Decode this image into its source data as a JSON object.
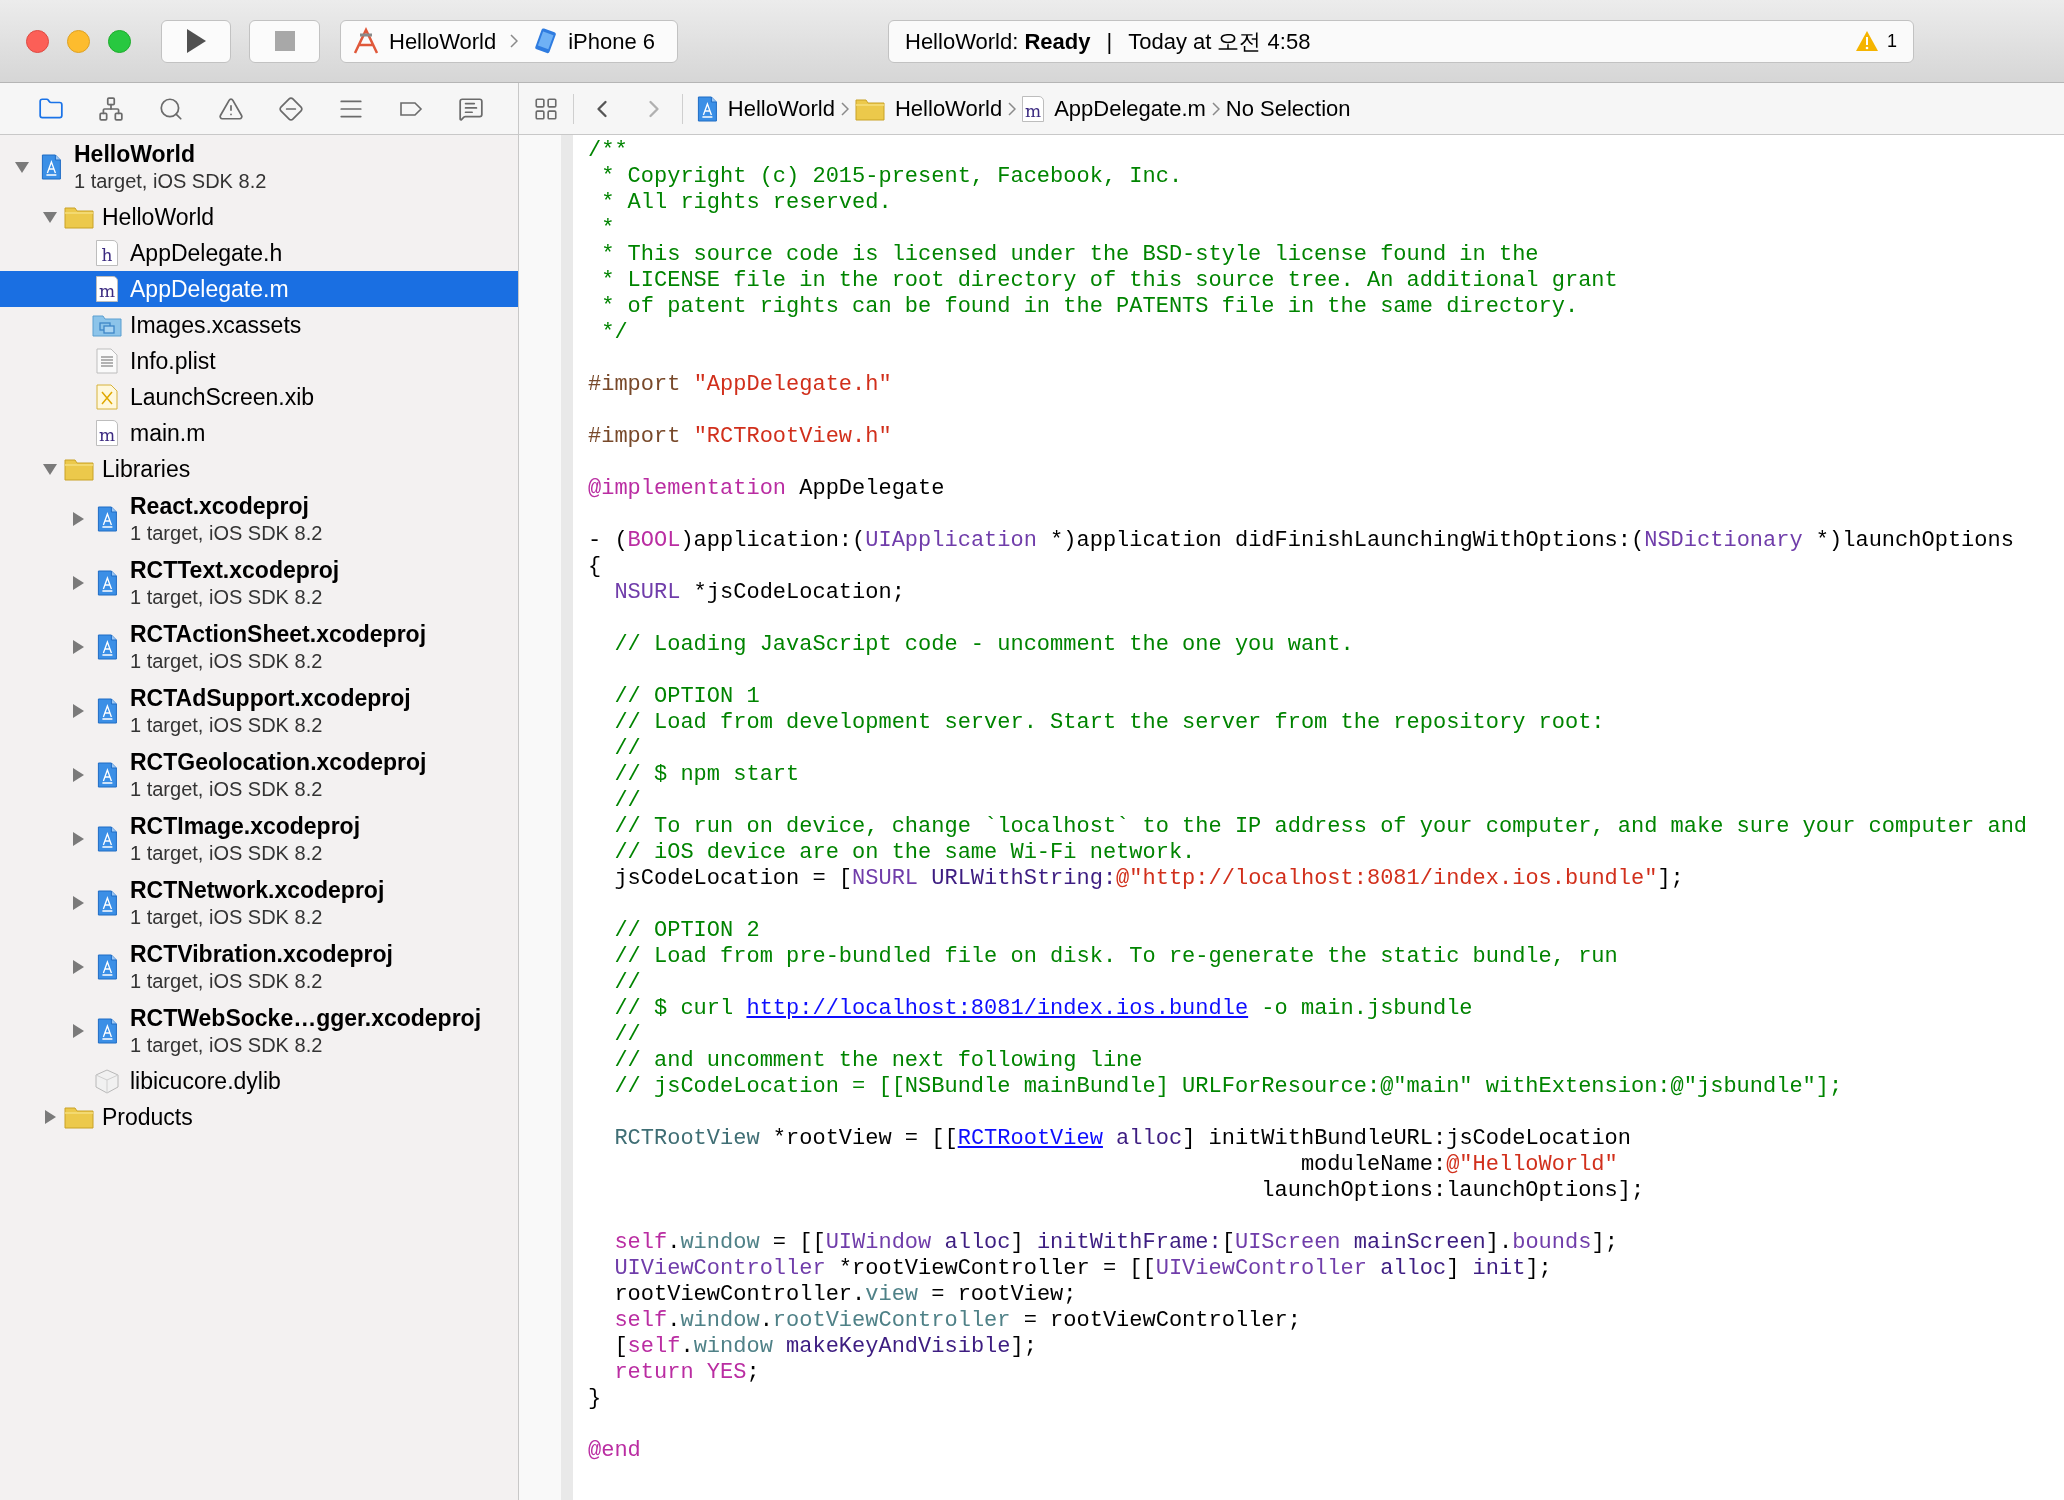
{
  "toolbar": {
    "scheme": {
      "project": "HelloWorld",
      "device": "iPhone 6"
    },
    "status": {
      "message": "HelloWorld: **Ready**",
      "separator": "|",
      "time": "Today at 오전 4:58"
    },
    "warnings": "1"
  },
  "navigator_tabs": [
    {
      "kind": "files",
      "selected": true
    },
    {
      "kind": "symbols",
      "selected": false
    },
    {
      "kind": "find",
      "selected": false
    },
    {
      "kind": "issues",
      "selected": false
    },
    {
      "kind": "tests",
      "selected": false
    },
    {
      "kind": "debug",
      "selected": false
    },
    {
      "kind": "breakpoints",
      "selected": false
    },
    {
      "kind": "reports",
      "selected": false
    }
  ],
  "jump_bar": [
    {
      "kind": "project",
      "label": "HelloWorld"
    },
    {
      "kind": "folder",
      "label": "HelloWorld"
    },
    {
      "kind": "source",
      "letter": "m",
      "label": "AppDelegate.m"
    },
    {
      "kind": "text",
      "label": "No Selection"
    }
  ],
  "project_navigator": {
    "items": [
      {
        "kind": "project",
        "name": "HelloWorld",
        "subtitle": "1 target, iOS SDK 8.2",
        "expanded": true,
        "selected": false,
        "children": [
          {
            "kind": "folder",
            "name": "HelloWorld",
            "expanded": true,
            "selected": false,
            "children": [
              {
                "kind": "source",
                "letter": "h",
                "name": "AppDelegate.h",
                "selected": false
              },
              {
                "kind": "source",
                "letter": "m",
                "name": "AppDelegate.m",
                "selected": true
              },
              {
                "kind": "assets",
                "name": "Images.xcassets",
                "selected": false
              },
              {
                "kind": "plist",
                "name": "Info.plist",
                "selected": false
              },
              {
                "kind": "xib",
                "name": "LaunchScreen.xib",
                "selected": false
              },
              {
                "kind": "source",
                "letter": "m",
                "name": "main.m",
                "selected": false
              }
            ]
          },
          {
            "kind": "folder",
            "name": "Libraries",
            "expanded": true,
            "selected": false,
            "children": [
              {
                "kind": "project",
                "name": "React.xcodeproj",
                "subtitle": "1 target, iOS SDK 8.2",
                "expanded": false,
                "selected": false
              },
              {
                "kind": "project",
                "name": "RCTText.xcodeproj",
                "subtitle": "1 target, iOS SDK 8.2",
                "expanded": false,
                "selected": false
              },
              {
                "kind": "project",
                "name": "RCTActionSheet.xcodeproj",
                "subtitle": "1 target, iOS SDK 8.2",
                "expanded": false,
                "selected": false
              },
              {
                "kind": "project",
                "name": "RCTAdSupport.xcodeproj",
                "subtitle": "1 target, iOS SDK 8.2",
                "expanded": false,
                "selected": false
              },
              {
                "kind": "project",
                "name": "RCTGeolocation.xcodeproj",
                "subtitle": "1 target, iOS SDK 8.2",
                "expanded": false,
                "selected": false
              },
              {
                "kind": "project",
                "name": "RCTImage.xcodeproj",
                "subtitle": "1 target, iOS SDK 8.2",
                "expanded": false,
                "selected": false
              },
              {
                "kind": "project",
                "name": "RCTNetwork.xcodeproj",
                "subtitle": "1 target, iOS SDK 8.2",
                "expanded": false,
                "selected": false
              },
              {
                "kind": "project",
                "name": "RCTVibration.xcodeproj",
                "subtitle": "1 target, iOS SDK 8.2",
                "expanded": false,
                "selected": false
              },
              {
                "kind": "project",
                "name": "RCTWebSocke…gger.xcodeproj",
                "subtitle": "1 target, iOS SDK 8.2",
                "expanded": false,
                "selected": false
              },
              {
                "kind": "dylib",
                "name": "libicucore.dylib",
                "selected": false
              }
            ]
          },
          {
            "kind": "folder",
            "name": "Products",
            "expanded": false,
            "selected": false
          }
        ]
      }
    ]
  },
  "editor": {
    "lines": [
      {
        "kind": "code",
        "tokens": [
          {
            "kind": "comment",
            "text": "/**"
          }
        ]
      },
      {
        "kind": "code",
        "tokens": [
          {
            "kind": "comment",
            "text": " * Copyright (c) 2015-present, Facebook, Inc."
          }
        ]
      },
      {
        "kind": "code",
        "tokens": [
          {
            "kind": "comment",
            "text": " * All rights reserved."
          }
        ]
      },
      {
        "kind": "code",
        "tokens": [
          {
            "kind": "comment",
            "text": " *"
          }
        ]
      },
      {
        "kind": "code",
        "tokens": [
          {
            "kind": "comment",
            "text": " * This source code is licensed under the BSD-style license found in the"
          }
        ]
      },
      {
        "kind": "code",
        "tokens": [
          {
            "kind": "comment",
            "text": " * LICENSE file in the root directory of this source tree. An additional grant"
          }
        ]
      },
      {
        "kind": "code",
        "tokens": [
          {
            "kind": "comment",
            "text": " * of patent rights can be found in the PATENTS file in the same directory."
          }
        ]
      },
      {
        "kind": "code",
        "tokens": [
          {
            "kind": "comment",
            "text": " */"
          }
        ]
      },
      {
        "kind": "blank"
      },
      {
        "kind": "code",
        "tokens": [
          {
            "kind": "directive",
            "text": "#import "
          },
          {
            "kind": "string",
            "text": "\"AppDelegate.h\""
          }
        ]
      },
      {
        "kind": "blank"
      },
      {
        "kind": "code",
        "tokens": [
          {
            "kind": "directive",
            "text": "#import "
          },
          {
            "kind": "string",
            "text": "\"RCTRootView.h\""
          }
        ]
      },
      {
        "kind": "blank"
      },
      {
        "kind": "code",
        "tokens": [
          {
            "kind": "keyword",
            "text": "@implementation"
          },
          {
            "kind": "plain",
            "text": " AppDelegate"
          }
        ]
      },
      {
        "kind": "blank"
      },
      {
        "kind": "code",
        "tokens": [
          {
            "kind": "plain",
            "text": "- ("
          },
          {
            "kind": "keyword",
            "text": "BOOL"
          },
          {
            "kind": "plain",
            "text": ")application:("
          },
          {
            "kind": "type",
            "text": "UIApplication"
          },
          {
            "kind": "plain",
            "text": " *)application didFinishLaunchingWithOptions:("
          },
          {
            "kind": "type",
            "text": "NSDictionary"
          },
          {
            "kind": "plain",
            "text": " *)launchOptions"
          }
        ]
      },
      {
        "kind": "code",
        "tokens": [
          {
            "kind": "plain",
            "text": "{"
          }
        ]
      },
      {
        "kind": "code",
        "tokens": [
          {
            "kind": "type",
            "text": "  NSURL"
          },
          {
            "kind": "plain",
            "text": " *jsCodeLocation;"
          }
        ]
      },
      {
        "kind": "blank"
      },
      {
        "kind": "code",
        "tokens": [
          {
            "kind": "comment",
            "text": "  // Loading JavaScript code - uncomment the one you want."
          }
        ]
      },
      {
        "kind": "blank"
      },
      {
        "kind": "code",
        "tokens": [
          {
            "kind": "comment",
            "text": "  // OPTION 1"
          }
        ]
      },
      {
        "kind": "code",
        "tokens": [
          {
            "kind": "comment",
            "text": "  // Load from development server. Start the server from the repository root:"
          }
        ]
      },
      {
        "kind": "code",
        "tokens": [
          {
            "kind": "comment",
            "text": "  //"
          }
        ]
      },
      {
        "kind": "code",
        "tokens": [
          {
            "kind": "comment",
            "text": "  // $ npm start"
          }
        ]
      },
      {
        "kind": "code",
        "tokens": [
          {
            "kind": "comment",
            "text": "  //"
          }
        ]
      },
      {
        "kind": "code",
        "tokens": [
          {
            "kind": "comment",
            "text": "  // To run on device, change `localhost` to the IP address of your computer, and make sure your computer and"
          }
        ]
      },
      {
        "kind": "code",
        "tokens": [
          {
            "kind": "comment",
            "text": "  // iOS device are on the same Wi-Fi network."
          }
        ]
      },
      {
        "kind": "code",
        "tokens": [
          {
            "kind": "plain",
            "text": "  jsCodeLocation = ["
          },
          {
            "kind": "type",
            "text": "NSURL"
          },
          {
            "kind": "method",
            "text": " URLWithString:"
          },
          {
            "kind": "string",
            "text": "@\"http://localhost:8081/index.ios.bundle\""
          },
          {
            "kind": "plain",
            "text": "];"
          }
        ]
      },
      {
        "kind": "blank"
      },
      {
        "kind": "code",
        "tokens": [
          {
            "kind": "comment",
            "text": "  // OPTION 2"
          }
        ]
      },
      {
        "kind": "code",
        "tokens": [
          {
            "kind": "comment",
            "text": "  // Load from pre-bundled file on disk. To re-generate the static bundle, run"
          }
        ]
      },
      {
        "kind": "code",
        "tokens": [
          {
            "kind": "comment",
            "text": "  //"
          }
        ]
      },
      {
        "kind": "code",
        "tokens": [
          {
            "kind": "comment",
            "text": "  // $ curl "
          },
          {
            "kind": "link",
            "text": "http://localhost:8081/index.ios.bundle"
          },
          {
            "kind": "comment",
            "text": " -o main.jsbundle"
          }
        ]
      },
      {
        "kind": "code",
        "tokens": [
          {
            "kind": "comment",
            "text": "  //"
          }
        ]
      },
      {
        "kind": "code",
        "tokens": [
          {
            "kind": "comment",
            "text": "  // and uncomment the next following line"
          }
        ]
      },
      {
        "kind": "code",
        "tokens": [
          {
            "kind": "comment",
            "text": "  // jsCodeLocation = [[NSBundle mainBundle] URLForResource:@\"main\" withExtension:@\"jsbundle\"];"
          }
        ]
      },
      {
        "kind": "blank"
      },
      {
        "kind": "code",
        "tokens": [
          {
            "kind": "class",
            "text": "  RCTRootView"
          },
          {
            "kind": "plain",
            "text": " *rootView = [["
          },
          {
            "kind": "link",
            "text": "RCTRootView"
          },
          {
            "kind": "method",
            "text": " alloc"
          },
          {
            "kind": "plain",
            "text": "] initWithBundleURL:jsCodeLocation"
          }
        ]
      },
      {
        "kind": "code",
        "tokens": [
          {
            "kind": "plain",
            "text": "                                                      moduleName:"
          },
          {
            "kind": "string",
            "text": "@\"HelloWorld\""
          }
        ]
      },
      {
        "kind": "code",
        "tokens": [
          {
            "kind": "plain",
            "text": "                                                   launchOptions:launchOptions];"
          }
        ]
      },
      {
        "kind": "blank"
      },
      {
        "kind": "code",
        "tokens": [
          {
            "kind": "keyword",
            "text": "  self"
          },
          {
            "kind": "plain",
            "text": "."
          },
          {
            "kind": "property",
            "text": "window"
          },
          {
            "kind": "plain",
            "text": " = [["
          },
          {
            "kind": "type",
            "text": "UIWindow"
          },
          {
            "kind": "method",
            "text": " alloc"
          },
          {
            "kind": "plain",
            "text": "] "
          },
          {
            "kind": "method",
            "text": "initWithFrame:"
          },
          {
            "kind": "plain",
            "text": "["
          },
          {
            "kind": "type",
            "text": "UIScreen"
          },
          {
            "kind": "method",
            "text": " mainScreen"
          },
          {
            "kind": "plain",
            "text": "]."
          },
          {
            "kind": "type",
            "text": "bounds"
          },
          {
            "kind": "plain",
            "text": "];"
          }
        ]
      },
      {
        "kind": "code",
        "tokens": [
          {
            "kind": "type",
            "text": "  UIViewController"
          },
          {
            "kind": "plain",
            "text": " *rootViewController = [["
          },
          {
            "kind": "type",
            "text": "UIViewController"
          },
          {
            "kind": "method",
            "text": " alloc"
          },
          {
            "kind": "plain",
            "text": "] "
          },
          {
            "kind": "method",
            "text": "init"
          },
          {
            "kind": "plain",
            "text": "];"
          }
        ]
      },
      {
        "kind": "code",
        "tokens": [
          {
            "kind": "plain",
            "text": "  rootViewController."
          },
          {
            "kind": "property",
            "text": "view"
          },
          {
            "kind": "plain",
            "text": " = rootView;"
          }
        ]
      },
      {
        "kind": "code",
        "tokens": [
          {
            "kind": "keyword",
            "text": "  self"
          },
          {
            "kind": "plain",
            "text": "."
          },
          {
            "kind": "property",
            "text": "window"
          },
          {
            "kind": "plain",
            "text": "."
          },
          {
            "kind": "property",
            "text": "rootViewController"
          },
          {
            "kind": "plain",
            "text": " = rootViewController;"
          }
        ]
      },
      {
        "kind": "code",
        "tokens": [
          {
            "kind": "plain",
            "text": "  ["
          },
          {
            "kind": "keyword",
            "text": "self"
          },
          {
            "kind": "plain",
            "text": "."
          },
          {
            "kind": "property",
            "text": "window"
          },
          {
            "kind": "method",
            "text": " makeKeyAndVisible"
          },
          {
            "kind": "plain",
            "text": "];"
          }
        ]
      },
      {
        "kind": "code",
        "tokens": [
          {
            "kind": "keyword",
            "text": "  return YES"
          },
          {
            "kind": "plain",
            "text": ";"
          }
        ]
      },
      {
        "kind": "code",
        "tokens": [
          {
            "kind": "plain",
            "text": "}"
          }
        ]
      },
      {
        "kind": "blank"
      },
      {
        "kind": "code",
        "tokens": [
          {
            "kind": "keyword",
            "text": "@end"
          }
        ]
      }
    ]
  }
}
